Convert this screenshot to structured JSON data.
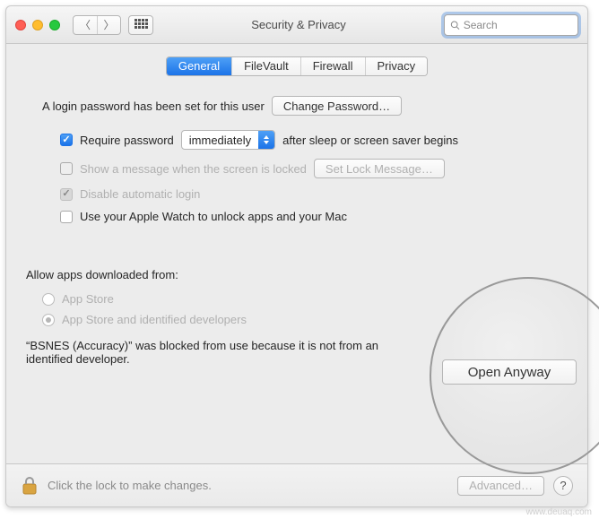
{
  "titlebar": {
    "title": "Security & Privacy",
    "search_placeholder": "Search"
  },
  "tabs": [
    "General",
    "FileVault",
    "Firewall",
    "Privacy"
  ],
  "general": {
    "login_password_text": "A login password has been set for this user",
    "change_password_btn": "Change Password…",
    "require_password_label": "Require password",
    "require_password_delay": "immediately",
    "require_password_tail": "after sleep or screen saver begins",
    "show_message_label": "Show a message when the screen is locked",
    "set_lock_message_btn": "Set Lock Message…",
    "disable_auto_login_label": "Disable automatic login",
    "apple_watch_label": "Use your Apple Watch to unlock apps and your Mac",
    "allow_apps_label": "Allow apps downloaded from:",
    "radio_appstore": "App Store",
    "radio_identified": "App Store and identified developers",
    "blocked_message": "“BSNES (Accuracy)” was blocked from use because it is not from an identified developer.",
    "open_anyway_btn": "Open Anyway"
  },
  "footer": {
    "lock_text": "Click the lock to make changes.",
    "advanced_btn": "Advanced…",
    "help_label": "?"
  },
  "watermark": "www.deuaq.com"
}
